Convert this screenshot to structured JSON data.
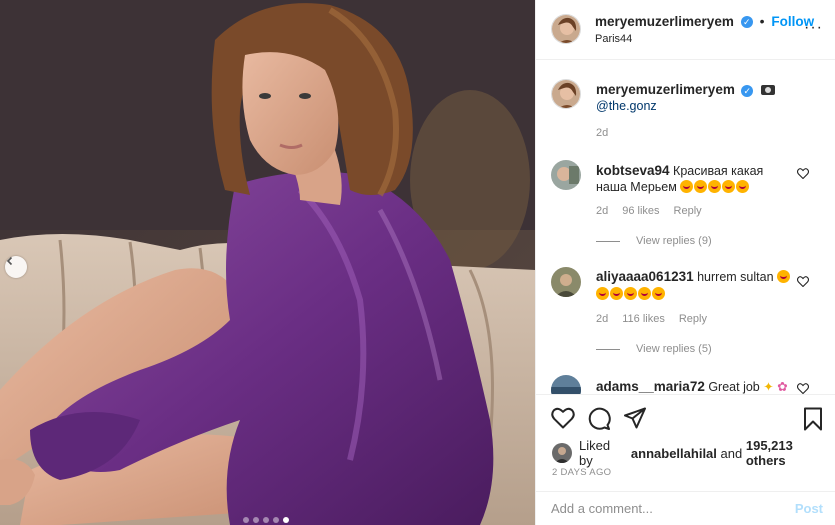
{
  "post": {
    "author": "meryemuzerlimeryem",
    "location": "Paris44",
    "follow_label": "Follow",
    "separator": "•",
    "more": "···"
  },
  "caption": {
    "author": "meryemuzerlimeryem",
    "mention": "@the.gonz",
    "age": "2d"
  },
  "comments": [
    {
      "author": "kobtseva94",
      "text_line1": "Красивая какая",
      "text_line2": "наша Мерьем",
      "age": "2d",
      "likes": "96 likes",
      "reply_label": "Reply",
      "view_replies": "View replies (9)"
    },
    {
      "author": "aliyaaaa061231",
      "text_line1": "hurrem sultan",
      "age": "2d",
      "likes": "116 likes",
      "reply_label": "Reply",
      "view_replies": "View replies (5)"
    },
    {
      "author": "adams__maria72",
      "text_line1": "Great job"
    }
  ],
  "likes": {
    "prefix": "Liked by",
    "user": "annabellahilal",
    "middle": "and",
    "count": "195,213 others"
  },
  "timestamp": "2 DAYS AGO",
  "comment_box": {
    "placeholder": "Add a comment...",
    "post_label": "Post"
  },
  "carousel": {
    "slide_count": 5,
    "active_index": 4
  },
  "colors": {
    "link": "#0095f6",
    "verified": "#3897f0",
    "post_disabled": "#b2dffc"
  },
  "icons": {
    "like": "heart-icon",
    "comment": "comment-icon",
    "share": "paper-plane-icon",
    "save": "bookmark-icon",
    "prev": "chevron-left-icon"
  }
}
